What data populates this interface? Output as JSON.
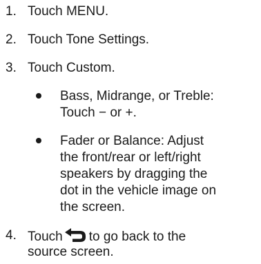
{
  "steps": [
    {
      "number": "1.",
      "text": "Touch MENU."
    },
    {
      "number": "2.",
      "text": "Touch Tone Settings."
    },
    {
      "number": "3.",
      "text": "Touch Custom."
    },
    {
      "number": "4.",
      "text_before": "Touch",
      "icon": "back-arrow-icon",
      "text_after": "to go back to the",
      "continuation": "source screen."
    }
  ],
  "bullets": [
    {
      "lines": [
        "Bass, Midrange, or Treble:",
        "Touch − or +."
      ]
    },
    {
      "lines": [
        "Fader or Balance: Adjust",
        "the front/rear or left/right",
        "speakers by dragging the",
        "dot in the vehicle image on",
        "the screen."
      ]
    }
  ]
}
